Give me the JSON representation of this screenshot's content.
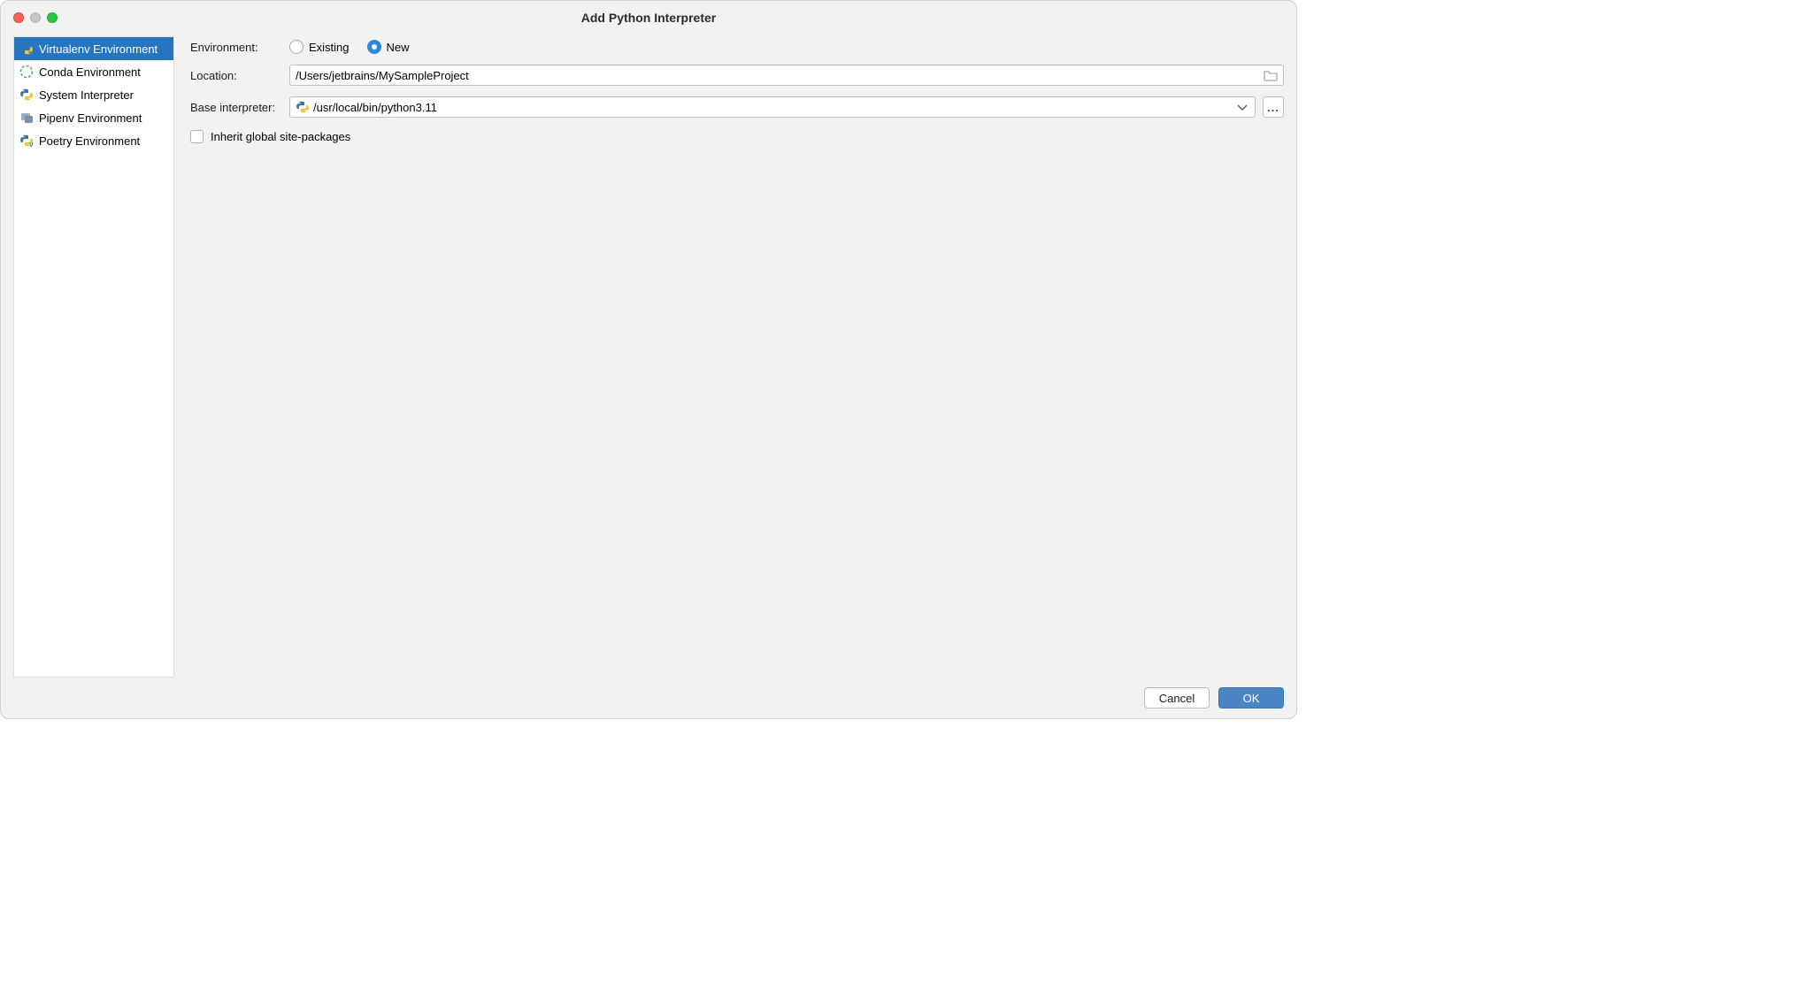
{
  "window_title": "Add Python Interpreter",
  "sidebar": {
    "items": [
      {
        "label": "Virtualenv Environment",
        "icon": "python-v",
        "selected": true
      },
      {
        "label": "Conda Environment",
        "icon": "conda",
        "selected": false
      },
      {
        "label": "System Interpreter",
        "icon": "python",
        "selected": false
      },
      {
        "label": "Pipenv Environment",
        "icon": "pipenv",
        "selected": false
      },
      {
        "label": "Poetry Environment",
        "icon": "python-v",
        "selected": false
      }
    ]
  },
  "main": {
    "environment_label": "Environment:",
    "radio_existing": "Existing",
    "radio_new": "New",
    "selected_radio": "new",
    "location_label": "Location:",
    "location_value": "/Users/jetbrains/MySampleProject",
    "base_label": "Base interpreter:",
    "base_value": "/usr/local/bin/python3.11",
    "ellipsis_label": "...",
    "inherit_label": "Inherit global site-packages",
    "inherit_checked": false
  },
  "footer": {
    "cancel": "Cancel",
    "ok": "OK"
  },
  "colors": {
    "selection": "#2675bf",
    "primary_button": "#4a86c5"
  }
}
